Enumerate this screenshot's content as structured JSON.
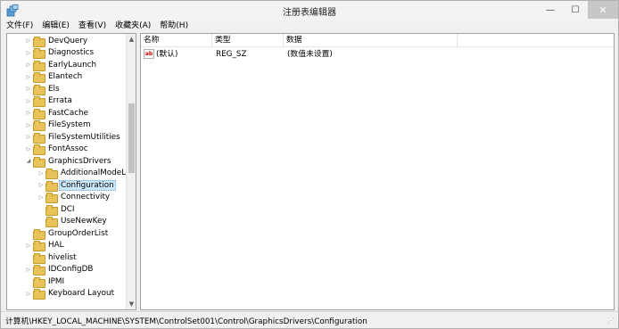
{
  "window": {
    "title": "注册表编辑器",
    "min_glyph": "—",
    "max_glyph": "☐",
    "close_glyph": "✕"
  },
  "menu": [
    "文件(F)",
    "编辑(E)",
    "查看(V)",
    "收藏夹(A)",
    "帮助(H)"
  ],
  "tree": {
    "items": [
      {
        "label": "DevQuery",
        "level": 1,
        "expander": "▷",
        "selected": false
      },
      {
        "label": "Diagnostics",
        "level": 1,
        "expander": "▷",
        "selected": false
      },
      {
        "label": "EarlyLaunch",
        "level": 1,
        "expander": "▷",
        "selected": false
      },
      {
        "label": "Elantech",
        "level": 1,
        "expander": "▷",
        "selected": false
      },
      {
        "label": "Els",
        "level": 1,
        "expander": "▷",
        "selected": false
      },
      {
        "label": "Errata",
        "level": 1,
        "expander": "▷",
        "selected": false
      },
      {
        "label": "FastCache",
        "level": 1,
        "expander": "▷",
        "selected": false
      },
      {
        "label": "FileSystem",
        "level": 1,
        "expander": "▷",
        "selected": false
      },
      {
        "label": "FileSystemUtilities",
        "level": 1,
        "expander": "▷",
        "selected": false
      },
      {
        "label": "FontAssoc",
        "level": 1,
        "expander": "▷",
        "selected": false
      },
      {
        "label": "GraphicsDrivers",
        "level": 1,
        "expander": "◢",
        "selected": false
      },
      {
        "label": "AdditionalModeLis",
        "level": 2,
        "expander": "▷",
        "selected": false
      },
      {
        "label": "Configuration",
        "level": 2,
        "expander": "▷",
        "selected": true
      },
      {
        "label": "Connectivity",
        "level": 2,
        "expander": "▷",
        "selected": false
      },
      {
        "label": "DCI",
        "level": 2,
        "expander": "",
        "selected": false
      },
      {
        "label": "UseNewKey",
        "level": 2,
        "expander": "",
        "selected": false
      },
      {
        "label": "GroupOrderList",
        "level": 1,
        "expander": "",
        "selected": false
      },
      {
        "label": "HAL",
        "level": 1,
        "expander": "▷",
        "selected": false
      },
      {
        "label": "hivelist",
        "level": 1,
        "expander": "",
        "selected": false
      },
      {
        "label": "IDConfigDB",
        "level": 1,
        "expander": "▷",
        "selected": false
      },
      {
        "label": "IPMI",
        "level": 1,
        "expander": "",
        "selected": false
      },
      {
        "label": "Keyboard Layout",
        "level": 1,
        "expander": "▷",
        "selected": false
      }
    ],
    "scroll_up_glyph": "▲",
    "scroll_down_glyph": "▼"
  },
  "values": {
    "columns": [
      "名称",
      "类型",
      "数据"
    ],
    "rows": [
      {
        "icon": "string-value-icon",
        "icon_text": "ab",
        "name": "(默认)",
        "type": "REG_SZ",
        "data": "(数值未设置)"
      }
    ]
  },
  "status": {
    "path": "计算机\\HKEY_LOCAL_MACHINE\\SYSTEM\\ControlSet001\\Control\\GraphicsDrivers\\Configuration"
  },
  "colors": {
    "selection_bg": "#cce8ff",
    "folder": "#e8c35a",
    "close_button": "#c7c7c7"
  }
}
